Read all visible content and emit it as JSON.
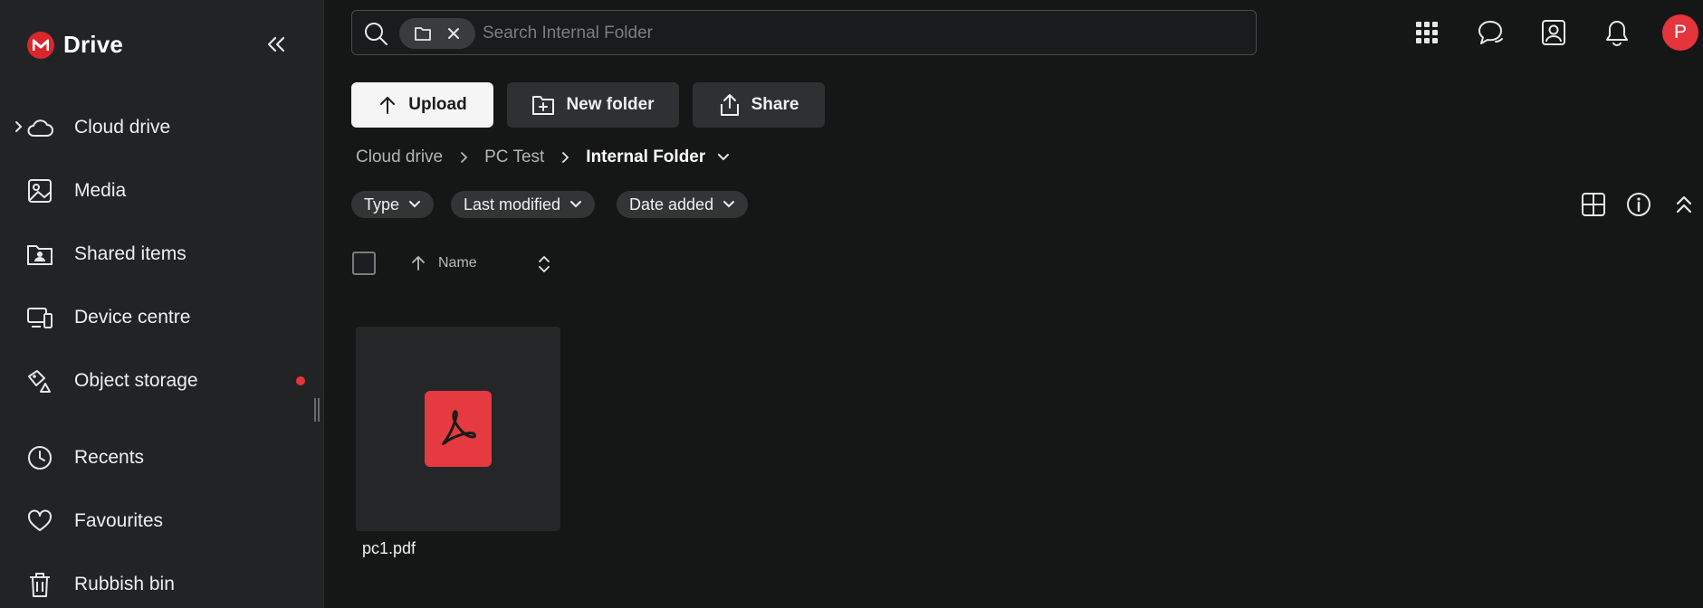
{
  "app": {
    "name": "Drive",
    "logo_letter": "M",
    "accent": "#d9272e"
  },
  "sidebar": {
    "items": [
      {
        "label": "Cloud drive",
        "icon": "cloud-icon",
        "has_chevron": true
      },
      {
        "label": "Media",
        "icon": "image-icon"
      },
      {
        "label": "Shared items",
        "icon": "shared-folder-icon"
      },
      {
        "label": "Device centre",
        "icon": "devices-icon"
      },
      {
        "label": "Object storage",
        "icon": "object-storage-icon",
        "notification_dot": true
      },
      {
        "label": "Recents",
        "icon": "clock-icon"
      },
      {
        "label": "Favourites",
        "icon": "heart-icon"
      },
      {
        "label": "Rubbish bin",
        "icon": "trash-icon"
      }
    ]
  },
  "search": {
    "placeholder": "Search Internal Folder",
    "value": ""
  },
  "header_icons": [
    "apps-grid-icon",
    "chat-icon",
    "contacts-icon",
    "bell-icon"
  ],
  "user": {
    "avatar_letter": "P",
    "avatar_color": "#e5343c"
  },
  "toolbar": {
    "upload_label": "Upload",
    "new_folder_label": "New folder",
    "share_label": "Share"
  },
  "breadcrumb": {
    "root": "Cloud drive",
    "parent": "PC Test",
    "current": "Internal Folder"
  },
  "filters": {
    "type": "Type",
    "last_modified": "Last modified",
    "date_added": "Date added"
  },
  "list_header": {
    "name_column": "Name"
  },
  "files": [
    {
      "name": "pc1.pdf",
      "type": "pdf",
      "icon": "pdf-icon",
      "tile_color": "#e53a3f"
    }
  ]
}
